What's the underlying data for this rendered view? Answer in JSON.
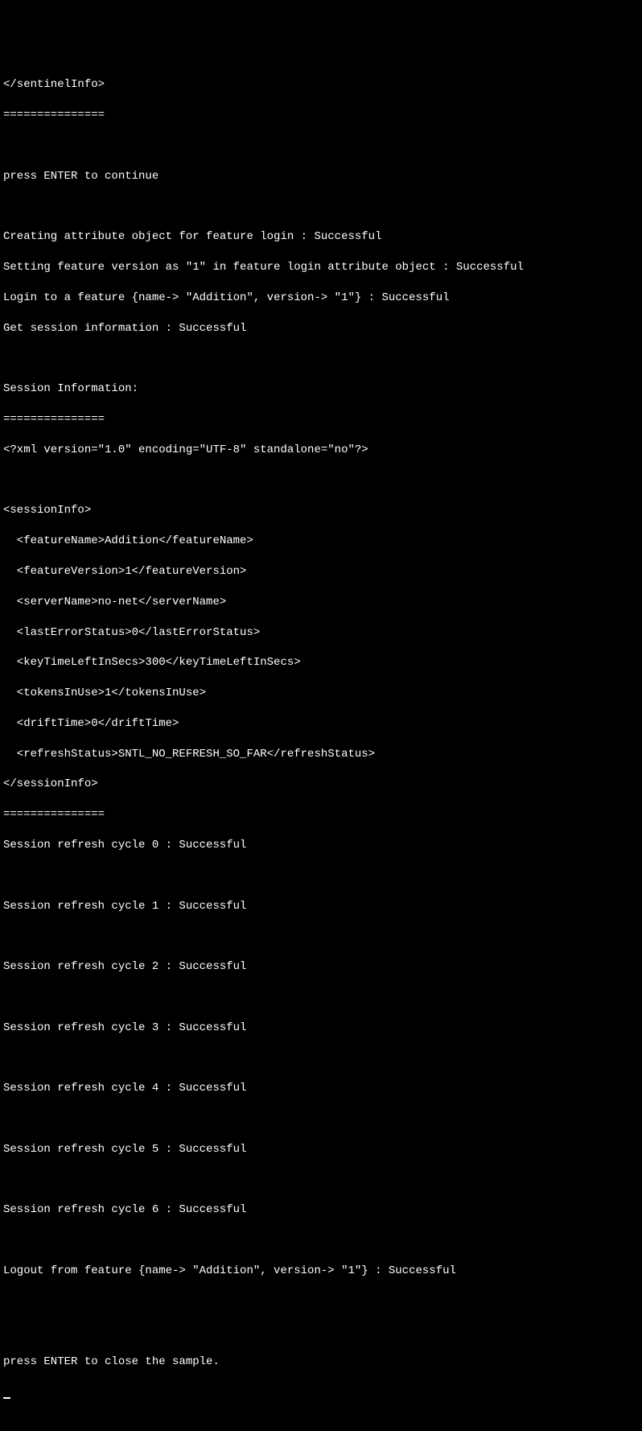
{
  "lines": {
    "l0": "</sentinelInfo>",
    "l1": "===============",
    "l2": "",
    "l3": "press ENTER to continue",
    "l4": "",
    "l5": "Creating attribute object for feature login : Successful",
    "l6": "Setting feature version as \"1\" in feature login attribute object : Successful",
    "l7": "Login to a feature {name-> \"Addition\", version-> \"1\"} : Successful",
    "l8": "Get session information : Successful",
    "l9": "",
    "l10": "Session Information:",
    "l11": "===============",
    "l12": "<?xml version=\"1.0\" encoding=\"UTF-8\" standalone=\"no\"?>",
    "l13": "",
    "l14": "<sessionInfo>",
    "l15": "  <featureName>Addition</featureName>",
    "l16": "  <featureVersion>1</featureVersion>",
    "l17": "  <serverName>no-net</serverName>",
    "l18": "  <lastErrorStatus>0</lastErrorStatus>",
    "l19": "  <keyTimeLeftInSecs>300</keyTimeLeftInSecs>",
    "l20": "  <tokensInUse>1</tokensInUse>",
    "l21": "  <driftTime>0</driftTime>",
    "l22": "  <refreshStatus>SNTL_NO_REFRESH_SO_FAR</refreshStatus>",
    "l23": "</sessionInfo>",
    "l24": "===============",
    "l25": "Session refresh cycle 0 : Successful",
    "l26": "",
    "l27": "Session refresh cycle 1 : Successful",
    "l28": "",
    "l29": "Session refresh cycle 2 : Successful",
    "l30": "",
    "l31": "Session refresh cycle 3 : Successful",
    "l32": "",
    "l33": "Session refresh cycle 4 : Successful",
    "l34": "",
    "l35": "Session refresh cycle 5 : Successful",
    "l36": "",
    "l37": "Session refresh cycle 6 : Successful",
    "l38": "",
    "l39": "Logout from feature {name-> \"Addition\", version-> \"1\"} : Successful",
    "l40": "",
    "l41": "",
    "l42": "press ENTER to close the sample."
  }
}
